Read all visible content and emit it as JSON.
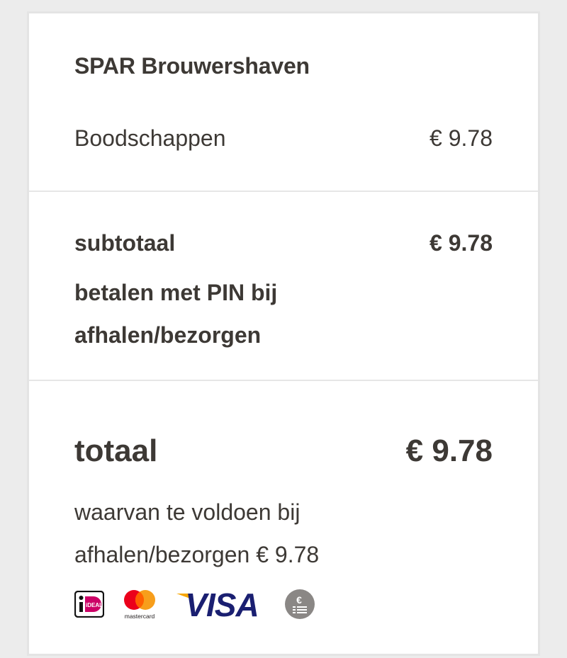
{
  "store": {
    "name": "SPAR Brouwershaven"
  },
  "items": [
    {
      "label": "Boodschappen",
      "value": "€ 9.78"
    }
  ],
  "subtotal": {
    "label": "subtotaal",
    "value": "€ 9.78",
    "payment_note": "betalen met PIN bij afhalen/bezorgen"
  },
  "total": {
    "label": "totaal",
    "value": "€ 9.78",
    "remaining_note": "waarvan te voldoen bij afhalen/bezorgen € 9.78"
  },
  "payment_methods": [
    {
      "icon": "ideal-icon",
      "text": "iDEAL"
    },
    {
      "icon": "mastercard-icon",
      "text": "mastercard"
    },
    {
      "icon": "visa-icon",
      "text": "VISA"
    },
    {
      "icon": "cash-receipt-icon",
      "text": "€"
    }
  ],
  "colors": {
    "text": "#3d3935",
    "visa_blue": "#1a1f71",
    "visa_gold": "#f7a600",
    "mastercard_red": "#eb001b",
    "mastercard_orange": "#f79e1b",
    "ideal_pink": "#cc0066",
    "cash_grey": "#8a8785"
  }
}
